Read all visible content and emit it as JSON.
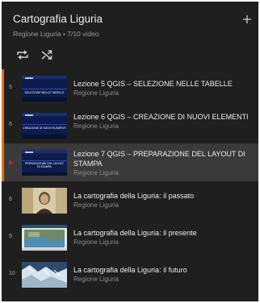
{
  "playlist": {
    "title": "Cartografia Liguria",
    "subtitle": "Regione Liguria • 7/10 video",
    "add_icon": "plus-icon"
  },
  "controls": {
    "loop_icon": "loop-icon",
    "shuffle_icon": "shuffle-icon"
  },
  "items": [
    {
      "index": "5",
      "title": "Lezione 5 QGIS – SELEZIONE NELLE TABELLE",
      "channel": "Regione Liguria",
      "thumb_text": "SELEZIONE NELLE TABELLE"
    },
    {
      "index": "6",
      "title": "Lezione 6 QGIS – CREAZIONE DI NUOVI ELEMENTI",
      "channel": "Regione Liguria",
      "thumb_text": "CREAZIONE DI NUOVI ELEMENTI"
    },
    {
      "index": "",
      "title": "Lezione 7 QGIS – PREPARAZIONE DEL LAYOUT DI STAMPA",
      "channel": "Regione Liguria",
      "thumb_text": "PREPARAZIONE DEL LAYOUT DI STAMPA",
      "now_playing": "▶"
    },
    {
      "index": "8",
      "title": "La cartografia della Liguria: il passato",
      "channel": "Regione Liguria"
    },
    {
      "index": "9",
      "title": "La cartografia della Liguria: il presente",
      "channel": "Regione Liguria"
    },
    {
      "index": "10",
      "title": "La cartografia della Liguria: il futuro",
      "channel": "Regione Liguria"
    }
  ],
  "colors": {
    "background": "#1f1f1f",
    "active_row": "#3a3a3a",
    "progress_marker": "#e8710a",
    "now_playing": "#cc2222"
  }
}
